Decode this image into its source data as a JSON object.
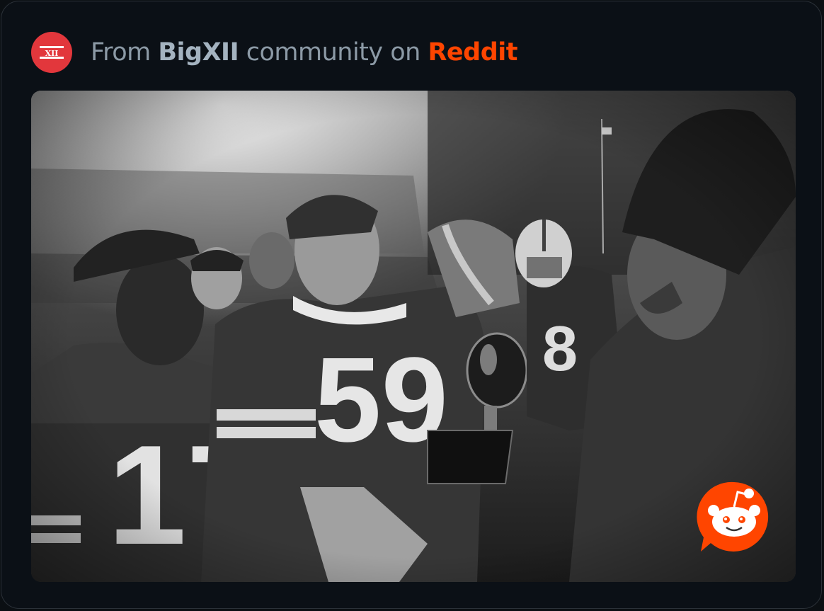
{
  "header": {
    "prefix": "From ",
    "community": "BigXII",
    "middle": " community on ",
    "brand": "Reddit",
    "avatar_icon": "big-xii-logo",
    "avatar_logo_text": "XII",
    "avatar_color": "#e2373c",
    "brand_color": "#ff4500"
  },
  "photo": {
    "kind": "black-and-white photograph",
    "overlay_icon": "reddit-snoo-icon",
    "overlay_color": "#ff4500"
  }
}
